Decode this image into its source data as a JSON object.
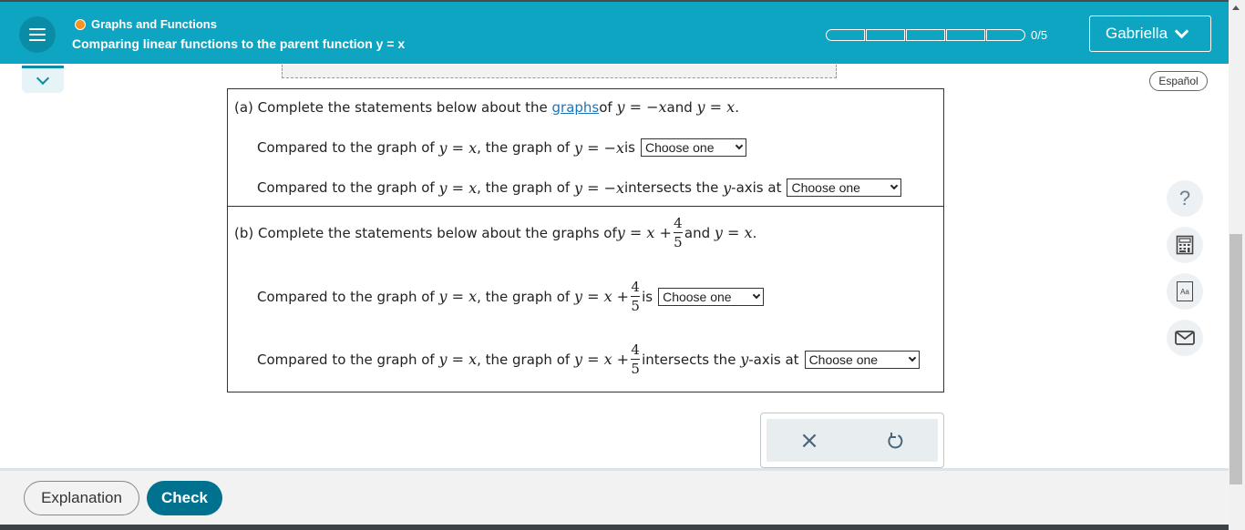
{
  "header": {
    "topic": "Graphs and Functions",
    "lesson_title": "Comparing linear functions to the parent function y = x",
    "progress": {
      "completed": 0,
      "total": 5,
      "label": "0/5"
    },
    "user_name": "Gabriella"
  },
  "language_button": "Español",
  "part_a": {
    "intro_prefix": "(a) Complete the statements below about the ",
    "intro_link": "graphs",
    "intro_of": " of ",
    "eq_neg": "y = −x",
    "intro_and": " and ",
    "eq_parent": "y = x",
    "intro_end": ".",
    "s1_prefix": "Compared to the graph of ",
    "s1_mid": ", the graph of ",
    "s1_is": " is",
    "s1_select": "Choose one",
    "s2_prefix": "Compared to the graph of ",
    "s2_mid": ", the graph of ",
    "s2_tail": " intersects the ",
    "s2_axis": "y",
    "s2_tail2": "-axis at",
    "s2_select": "Choose one"
  },
  "part_b": {
    "intro_prefix": "(b) Complete the statements below about the graphs of ",
    "eq_shift_lhs": "y = x +",
    "frac_num": "4",
    "frac_den": "5",
    "intro_and": " and ",
    "eq_parent": "y = x",
    "intro_end": ".",
    "s1_prefix": "Compared to the graph of ",
    "s1_mid": ", the graph of ",
    "s1_is": " is",
    "s1_select": "Choose one",
    "s2_prefix": "Compared to the graph of ",
    "s2_mid": ", the graph of ",
    "s2_tail": " intersects the ",
    "s2_axis": "y",
    "s2_tail2": "-axis at",
    "s2_select": "Choose one"
  },
  "side_tools": {
    "help": "?",
    "calculator": "calculator-icon",
    "reference": "Aa",
    "message": "mail-icon"
  },
  "actions": {
    "clear": "×",
    "undo": "undo-icon"
  },
  "footer": {
    "explanation_label": "Explanation",
    "check_label": "Check"
  },
  "colors": {
    "header_bg": "#0ea5c2",
    "topic_dot": "#f7931e",
    "check_bg": "#00728f",
    "link": "#1b75bb"
  }
}
